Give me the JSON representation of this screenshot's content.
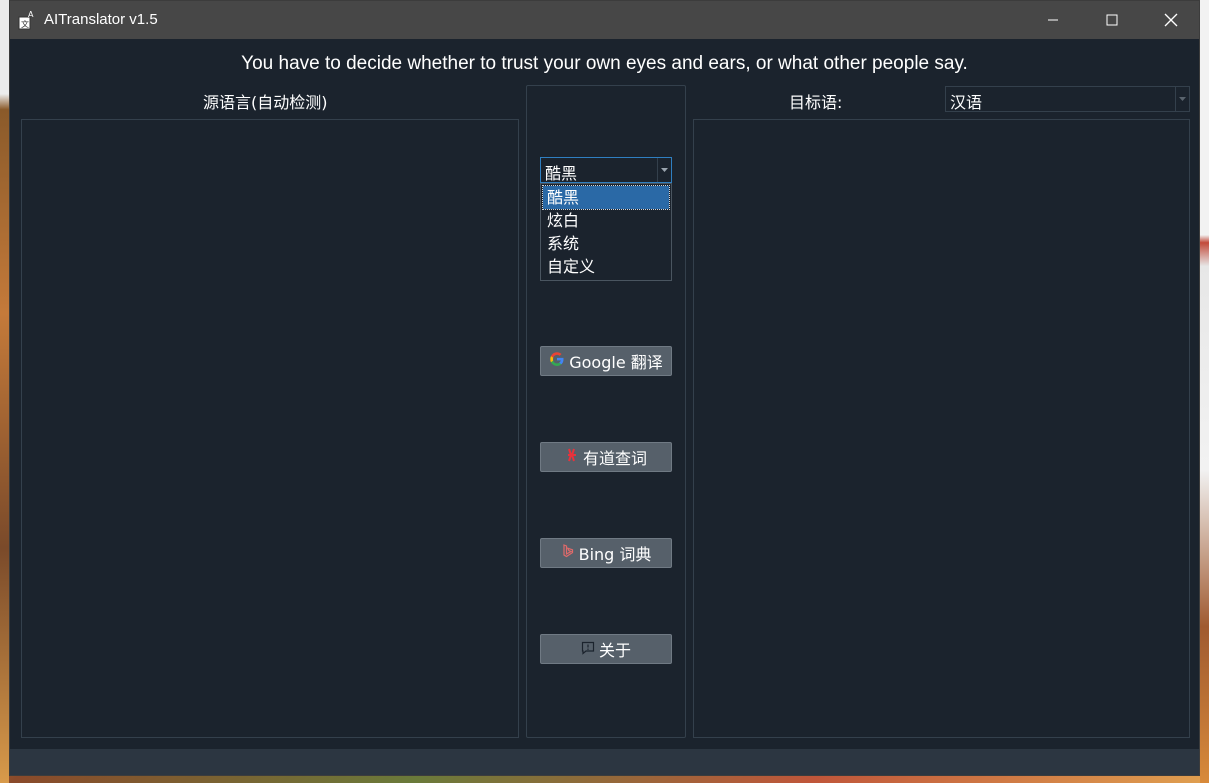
{
  "window": {
    "title": "AITranslator  v1.5",
    "minimize_icon": "minimize-icon",
    "maximize_icon": "maximize-icon",
    "close_icon": "close-icon"
  },
  "quote": "You have to decide whether to trust your own eyes and ears, or what other people say.",
  "source": {
    "label": "源语言(自动检测)",
    "text": ""
  },
  "target": {
    "label": "目标语:",
    "language": "汉语",
    "text": ""
  },
  "theme": {
    "selected": "酷黑",
    "options": [
      "酷黑",
      "炫白",
      "系统",
      "自定义"
    ]
  },
  "buttons": {
    "google": "Google 翻译",
    "youdao": "有道查词",
    "bing": "Bing 词典",
    "about": "关于"
  },
  "colors": {
    "window_bg": "#1b232d",
    "titlebar_bg": "#474747",
    "button_bg": "#56606a",
    "selection": "#2a69a6",
    "focus_border": "#2f7fc1"
  }
}
